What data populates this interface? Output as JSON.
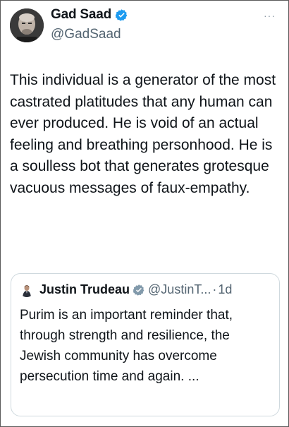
{
  "tweet": {
    "author_name": "Gad Saad",
    "author_handle": "@GadSaad",
    "more_icon": "ellipsis-icon",
    "text": "This individual is a generator of the most castrated platitudes that any human can ever produced. He is void of an actual feeling and breathing personhood. He is a soulless bot that generates grotesque vacuous messages of faux-empathy."
  },
  "quoted": {
    "author_name": "Justin Trudeau",
    "author_handle": "@JustinT...",
    "separator": "·",
    "time": "1d",
    "text": "Purim is an important reminder that, through strength and resilience, the Jewish community has overcome persecution time and again. ..."
  },
  "colors": {
    "verified": "#1d9bf0",
    "secondary_text": "#536471",
    "border": "#cfd9de"
  }
}
